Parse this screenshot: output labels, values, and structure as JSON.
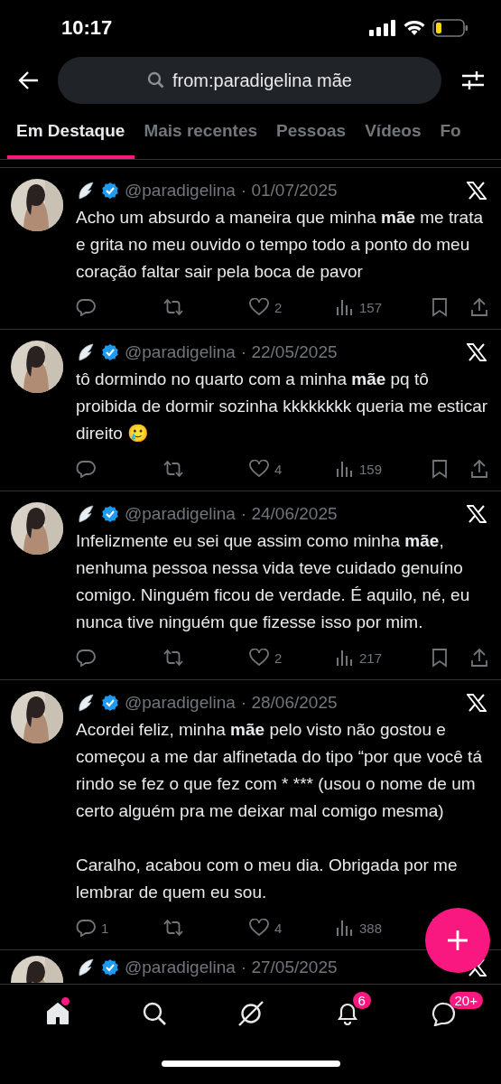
{
  "status_bar": {
    "time": "10:17"
  },
  "search": {
    "value": "from:paradigelina mãe"
  },
  "tabs": [
    {
      "label": "Em Destaque",
      "selected": true
    },
    {
      "label": "Mais recentes",
      "selected": false
    },
    {
      "label": "Pessoas",
      "selected": false
    },
    {
      "label": "Vídeos",
      "selected": false
    },
    {
      "label": "Fo",
      "selected": false
    }
  ],
  "tweets": [
    {
      "handle": "@paradigelina",
      "date": "· 01/07/2025",
      "paragraphs": [
        "Acho um absurdo a maneira que minha **mãe** me trata e grita no meu ouvido o tempo todo a ponto do meu coração faltar sair pela boca de pavor"
      ],
      "likes": "2",
      "views": "157"
    },
    {
      "handle": "@paradigelina",
      "date": "· 22/05/2025",
      "paragraphs": [
        "tô dormindo no quarto com a minha **mãe** pq tô proibida de dormir sozinha kkkkkkkk queria me esticar direito 🥲"
      ],
      "likes": "4",
      "views": "159"
    },
    {
      "handle": "@paradigelina",
      "date": "· 24/06/2025",
      "paragraphs": [
        "Infelizmente eu sei que assim como minha **mãe**, nenhuma pessoa nessa vida teve cuidado genuíno comigo. Ninguém ficou de verdade. É aquilo, né, eu nunca tive ninguém que fizesse isso por mim."
      ],
      "likes": "2",
      "views": "217"
    },
    {
      "handle": "@paradigelina",
      "date": "· 28/06/2025",
      "paragraphs": [
        "Acordei feliz, minha **mãe** pelo visto não gostou e começou a me dar alfinetada do tipo “por que você tá rindo se fez o que fez com * *** (usou o nome de um certo alguém pra me deixar mal comigo mesma)",
        "Caralho, acabou com o meu dia. Obrigada por me lembrar de quem eu sou."
      ],
      "replies": "1",
      "likes": "4",
      "views": "388"
    },
    {
      "handle": "@paradigelina",
      "date": "· 27/05/2025"
    }
  ],
  "nav": [
    {
      "kind": "home",
      "selected": true,
      "dot": true
    },
    {
      "kind": "search",
      "selected": false
    },
    {
      "kind": "grok",
      "selected": false
    },
    {
      "kind": "notifications",
      "selected": false,
      "badge": "6"
    },
    {
      "kind": "messages",
      "selected": false,
      "badge": "20+"
    }
  ]
}
